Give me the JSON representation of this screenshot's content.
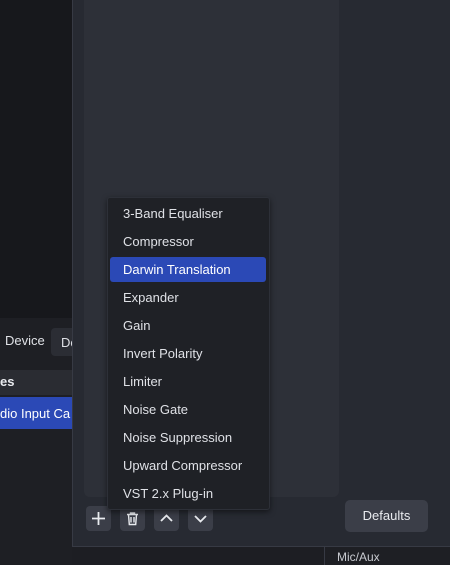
{
  "background_panel": {
    "device_label": "Device",
    "device_combo_value": "De",
    "sources_header": "es",
    "sources_selected_item": "dio Input Ca"
  },
  "dialog": {
    "toolbar": {
      "add_icon": "plus-icon",
      "remove_icon": "trash-icon",
      "move_up_icon": "chevron-up-icon",
      "move_down_icon": "chevron-down-icon"
    },
    "defaults_label": "Defaults"
  },
  "mixer": {
    "channel_label": "Mic/Aux"
  },
  "filter_menu": {
    "items": [
      {
        "label": "3-Band Equaliser"
      },
      {
        "label": "Compressor"
      },
      {
        "label": "Darwin Translation",
        "highlighted": true
      },
      {
        "label": "Expander"
      },
      {
        "label": "Gain"
      },
      {
        "label": "Invert Polarity"
      },
      {
        "label": "Limiter"
      },
      {
        "label": "Noise Gate"
      },
      {
        "label": "Noise Suppression"
      },
      {
        "label": "Upward Compressor"
      },
      {
        "label": "VST 2.x Plug-in"
      }
    ]
  },
  "colors": {
    "accent": "#2b49b6",
    "dialog_bg": "#272a32",
    "menu_bg": "#1f2126"
  }
}
